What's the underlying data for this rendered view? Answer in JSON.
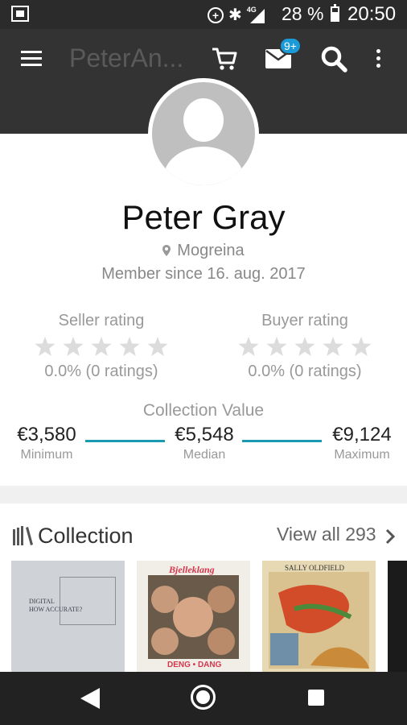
{
  "status_bar": {
    "battery_percent": "28 %",
    "network": "4G",
    "time": "20:50"
  },
  "app_bar": {
    "title": "PeterAn...",
    "mail_badge": "9+"
  },
  "profile": {
    "name": "Peter Gray",
    "location": "Mogreina",
    "member_since": "Member since 16. aug. 2017"
  },
  "ratings": {
    "seller": {
      "title": "Seller rating",
      "value": "0.0% (0 ratings)",
      "stars": 0
    },
    "buyer": {
      "title": "Buyer rating",
      "value": "0.0% (0 ratings)",
      "stars": 0
    }
  },
  "collection_value": {
    "title": "Collection Value",
    "minimum": {
      "value": "€3,580",
      "label": "Minimum"
    },
    "median": {
      "value": "€5,548",
      "label": "Median"
    },
    "maximum": {
      "value": "€9,124",
      "label": "Maximum"
    }
  },
  "collection": {
    "title": "Collection",
    "view_all": "View all 293",
    "items": [
      {
        "cover_text": "DIGITAL\nHOW ACCURATE?"
      },
      {
        "cover_text": "Bjelleklang",
        "cover_subtext": "DENG • DANG"
      },
      {
        "cover_text": "SALLY OLDFIELD"
      },
      {
        "cover_text": ""
      }
    ]
  },
  "colors": {
    "app_bar": "#333333",
    "accent": "#1a9ab0",
    "badge": "#1a9ad6"
  }
}
